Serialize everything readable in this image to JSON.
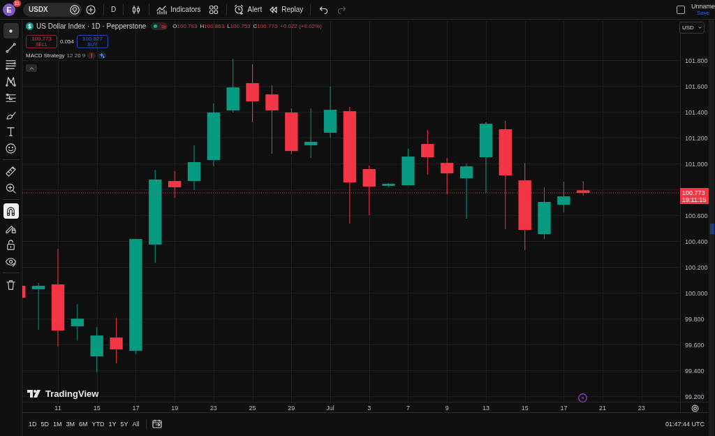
{
  "topbar": {
    "avatar_letter": "E",
    "notification_count": "11",
    "symbol": "USDX",
    "interval": "D",
    "indicators_label": "Indicators",
    "alert_label": "Alert",
    "replay_label": "Replay",
    "undo_disabled": false,
    "redo_disabled": true,
    "layout_name": "Unname",
    "save_label": "Save"
  },
  "drawing_toolbar": {
    "groups": [
      {
        "items": [
          {
            "selected": true
          },
          {
            "selected": false
          },
          {
            "selected": false
          },
          {
            "selected": false
          },
          {
            "selected": false
          },
          {
            "selected": false
          },
          {
            "selected": false
          },
          {
            "selected": false
          }
        ]
      },
      {
        "items": [
          {
            "selected": false
          },
          {
            "selected": false
          }
        ]
      },
      {
        "items": [
          {
            "on": true
          },
          {
            "on": false
          },
          {
            "on": false
          },
          {
            "on": false
          }
        ]
      },
      {
        "items": [
          {
            "selected": false
          }
        ]
      }
    ]
  },
  "legend": {
    "title": "US Dollar Index · 1D · Pepperstone",
    "ohlc": [
      {
        "label": "O",
        "value": "100.793"
      },
      {
        "label": "H",
        "value": "100.863"
      },
      {
        "label": "L",
        "value": "100.753"
      },
      {
        "label": "C",
        "value": "100.773"
      }
    ],
    "change": "+0.022 (+0.02%)"
  },
  "trade": {
    "sell_price": "100.773",
    "sell_label": "SELL",
    "spread": "0.054",
    "buy_price": "100.827",
    "buy_label": "BUY"
  },
  "indicator": {
    "name": "MACD Strategy",
    "params": "12 26 9"
  },
  "currency": "USD",
  "price_tag": {
    "price": "100.773",
    "countdown": "19:11:15"
  },
  "brand": "TradingView",
  "price_axis": {
    "labels": [
      "101.800",
      "101.600",
      "101.400",
      "101.200",
      "101.000",
      "100.600",
      "100.400",
      "100.200",
      "100.000",
      "99.800",
      "99.600",
      "99.400",
      "99.200"
    ]
  },
  "date_axis": {
    "labels": [
      "11",
      "15",
      "17",
      "19",
      "23",
      "25",
      "29",
      "Jul",
      "3",
      "7",
      "9",
      "13",
      "15",
      "17",
      "21",
      "23"
    ]
  },
  "timeframes": [
    "1D",
    "5D",
    "1M",
    "3M",
    "6M",
    "YTD",
    "1Y",
    "5Y",
    "All"
  ],
  "clock": "01:47:44 UTC"
}
